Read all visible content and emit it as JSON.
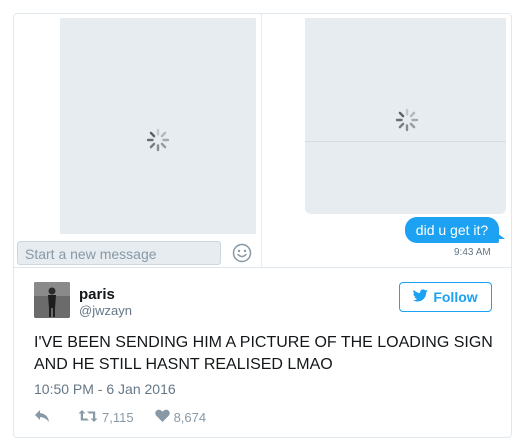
{
  "dm": {
    "message_text": "did u get it?",
    "message_time": "9:43 AM",
    "input_placeholder": "Start a new message",
    "icons": {
      "attachment_loading": "loading-spinner-icon",
      "emoji": "smiley-icon"
    }
  },
  "tweet": {
    "author_name": "paris",
    "author_handle": "@jwzayn",
    "follow_label": "Follow",
    "text": "I'VE BEEN SENDING HIM A PICTURE OF THE LOADING SIGN AND HE STILL HASNT REALISED LMAO",
    "timestamp": "10:50 PM - 6 Jan 2016",
    "retweet_count": "7,115",
    "like_count": "8,674",
    "icons": {
      "bird": "twitter-bird-icon",
      "reply": "reply-icon",
      "retweet": "retweet-icon",
      "like": "heart-icon"
    }
  },
  "colors": {
    "brand_blue": "#1da1f2",
    "placeholder_gray": "#e6ecf0",
    "secondary_text": "#657786",
    "primary_text": "#14171a"
  }
}
